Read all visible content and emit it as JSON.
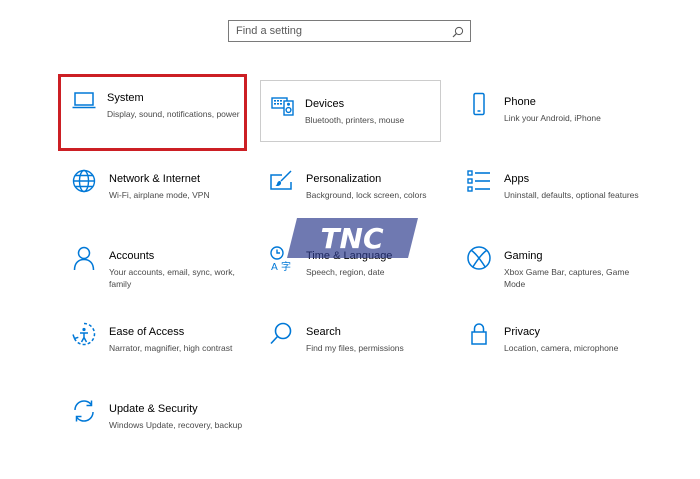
{
  "search": {
    "placeholder": "Find a setting",
    "icon": "search-icon"
  },
  "tiles": [
    {
      "id": "system",
      "icon": "laptop-icon",
      "title": "System",
      "description": "Display, sound, notifications, power"
    },
    {
      "id": "devices",
      "icon": "keyboard-speaker-icon",
      "title": "Devices",
      "description": "Bluetooth, printers, mouse"
    },
    {
      "id": "phone",
      "icon": "phone-icon",
      "title": "Phone",
      "description": "Link your Android, iPhone"
    },
    {
      "id": "network",
      "icon": "globe-icon",
      "title": "Network & Internet",
      "description": "Wi-Fi, airplane mode, VPN"
    },
    {
      "id": "personalization",
      "icon": "paint-brush-icon",
      "title": "Personalization",
      "description": "Background, lock screen, colors"
    },
    {
      "id": "apps",
      "icon": "app-list-icon",
      "title": "Apps",
      "description": "Uninstall, defaults, optional features"
    },
    {
      "id": "accounts",
      "icon": "person-icon",
      "title": "Accounts",
      "description": "Your accounts, email, sync, work, family"
    },
    {
      "id": "time-language",
      "icon": "language-icon",
      "title": "Time & Language",
      "description": "Speech, region, date"
    },
    {
      "id": "gaming",
      "icon": "xbox-icon",
      "title": "Gaming",
      "description": "Xbox Game Bar, captures, Game Mode"
    },
    {
      "id": "ease-of-access",
      "icon": "ease-of-access-icon",
      "title": "Ease of Access",
      "description": "Narrator, magnifier, high contrast"
    },
    {
      "id": "search-settings",
      "icon": "search-icon",
      "title": "Search",
      "description": "Find my files, permissions"
    },
    {
      "id": "privacy",
      "icon": "lock-icon",
      "title": "Privacy",
      "description": "Location, camera, microphone"
    },
    {
      "id": "update-security",
      "icon": "refresh-icon",
      "title": "Update & Security",
      "description": "Windows Update, recovery, backup"
    }
  ],
  "selected_tile": "system",
  "watermark": {
    "text": "TNC"
  },
  "colors": {
    "accent": "#0078d7",
    "highlight_border": "#cc1f24",
    "watermark": "#2b3a8c"
  }
}
